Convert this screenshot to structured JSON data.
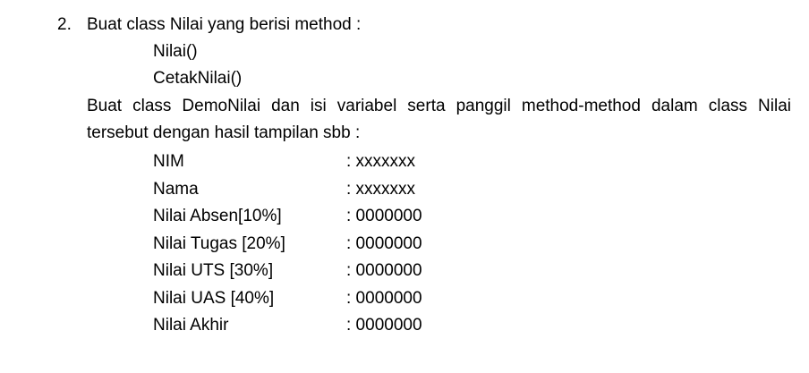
{
  "item": {
    "number": "2.",
    "instruction": "Buat class Nilai yang berisi method :",
    "methods": [
      "Nilai()",
      "CetakNilai()"
    ],
    "paragraph_line1": "Buat class DemoNilai dan isi variabel serta panggil method-method dalam class Nilai",
    "paragraph_line2": "tersebut dengan hasil tampilan sbb :"
  },
  "output_rows": [
    {
      "label": "NIM",
      "value": ": xxxxxxx"
    },
    {
      "label": "Nama",
      "value": ": xxxxxxx"
    },
    {
      "label": "Nilai Absen[10%]",
      "value": ": 0000000"
    },
    {
      "label": "Nilai Tugas [20%]",
      "value": ": 0000000"
    },
    {
      "label": "Nilai UTS [30%]",
      "value": ": 0000000"
    },
    {
      "label": "Nilai UAS [40%]",
      "value": ": 0000000"
    },
    {
      "label": "Nilai Akhir",
      "value": ": 0000000"
    }
  ]
}
